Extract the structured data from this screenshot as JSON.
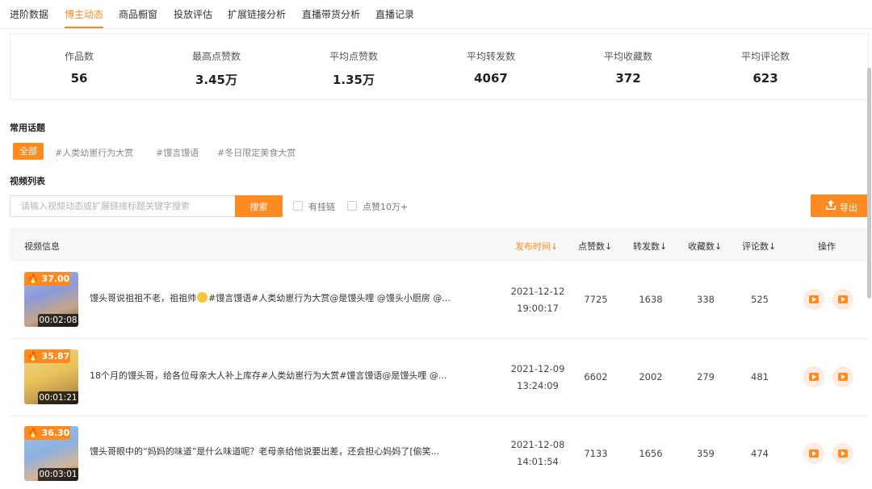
{
  "tabs": [
    {
      "label": "进阶数据"
    },
    {
      "label": "博主动态",
      "active": true
    },
    {
      "label": "商品橱窗"
    },
    {
      "label": "投放评估"
    },
    {
      "label": "扩展链接分析"
    },
    {
      "label": "直播带货分析"
    },
    {
      "label": "直播记录"
    }
  ],
  "stats": [
    {
      "label": "作品数",
      "value": "56"
    },
    {
      "label": "最高点赞数",
      "value": "3.45万"
    },
    {
      "label": "平均点赞数",
      "value": "1.35万"
    },
    {
      "label": "平均转发数",
      "value": "4067"
    },
    {
      "label": "平均收藏数",
      "value": "372"
    },
    {
      "label": "平均评论数",
      "value": "623"
    }
  ],
  "topics": {
    "title": "常用话题",
    "all_label": "全部",
    "items": [
      "#人类幼崽行为大赏",
      "#馒言馒语",
      "#冬日限定美食大赏"
    ]
  },
  "video_list": {
    "title": "视频列表",
    "search_placeholder": "请输入视频动态或扩展链接标题关键字搜索",
    "search_button": "搜索",
    "filter_link": "有挂链",
    "filter_likes": "点赞10万+",
    "export_label": "导出"
  },
  "table": {
    "headers": {
      "info": "视频信息",
      "publish_time": "发布时间↓",
      "likes": "点赞数↓",
      "shares": "转发数↓",
      "favorites": "收藏数↓",
      "comments": "评论数↓",
      "actions": "操作"
    },
    "rows": [
      {
        "heat": "37.00",
        "duration": "00:02:08",
        "title_pre": "馒头哥说祖祖不老，祖祖帅",
        "title_post": "#馒言馒语#人类幼崽行为大赏@是馒头哩 @馒头小厨房 @...",
        "date": "2021-12-12",
        "time": "19:00:17",
        "likes": "7725",
        "shares": "1638",
        "favorites": "338",
        "comments": "525"
      },
      {
        "heat": "35.87",
        "duration": "00:01:21",
        "title_pre": "18个月的馒头哥，给各位母亲大人补上库存#人类幼崽行为大赏#馒言馒语@是馒头哩 @...",
        "title_post": "",
        "date": "2021-12-09",
        "time": "13:24:09",
        "likes": "6602",
        "shares": "2002",
        "favorites": "279",
        "comments": "481"
      },
      {
        "heat": "36.30",
        "duration": "00:03:01",
        "title_pre": "馒头哥眼中的“妈妈的味道”是什么味道呢？老母亲给他说要出差，还会担心妈妈了[偷笑...",
        "title_post": "",
        "date": "2021-12-08",
        "time": "14:01:54",
        "likes": "7133",
        "shares": "1656",
        "favorites": "359",
        "comments": "474"
      }
    ]
  },
  "colors": {
    "accent": "#ff8a1f",
    "action_bg": "#ffece0"
  },
  "icons": [
    "flame-icon",
    "upload-icon",
    "video-action-icon",
    "play-action-icon"
  ]
}
